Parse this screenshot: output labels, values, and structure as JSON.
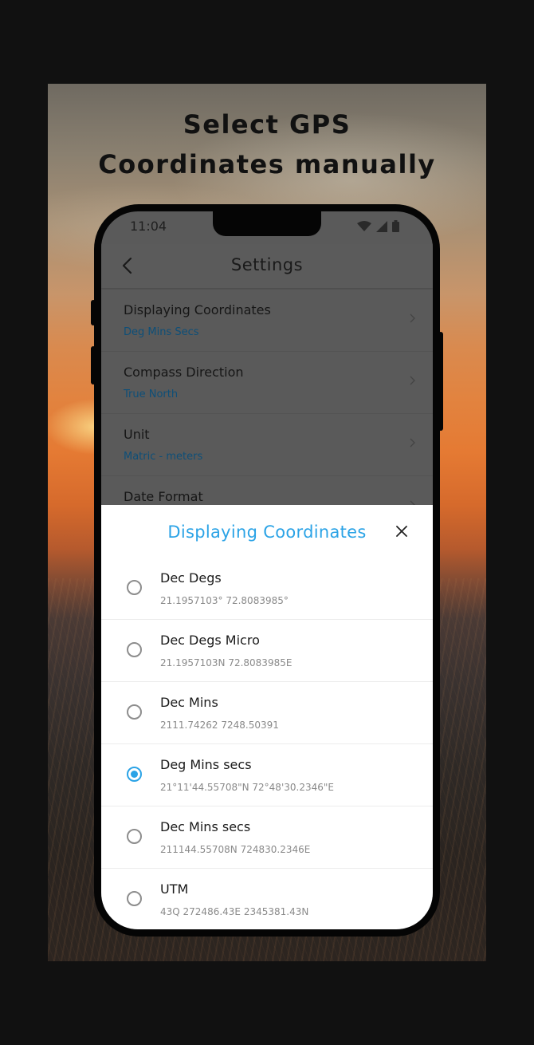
{
  "headline": {
    "line1": "Select GPS",
    "line2": "Coordinates manually"
  },
  "status_bar": {
    "time": "11:04",
    "icons": [
      "wifi-icon",
      "signal-icon",
      "battery-icon"
    ]
  },
  "app_bar": {
    "back_icon": "chevron-left-icon",
    "title": "Settings"
  },
  "settings": [
    {
      "title": "Displaying Coordinates",
      "value": "Deg Mins Secs"
    },
    {
      "title": "Compass Direction",
      "value": "True North"
    },
    {
      "title": "Unit",
      "value": "Matric - meters"
    },
    {
      "title": "Date Format",
      "value": ""
    }
  ],
  "sheet": {
    "title": "Displaying Coordinates",
    "close_icon": "close-icon",
    "options": [
      {
        "label": "Dec Degs",
        "sample": "21.1957103°  72.8083985°",
        "selected": false
      },
      {
        "label": "Dec Degs Micro",
        "sample": "21.1957103N  72.8083985E",
        "selected": false
      },
      {
        "label": "Dec Mins",
        "sample": "2111.74262  7248.50391",
        "selected": false
      },
      {
        "label": "Deg Mins secs",
        "sample": "21°11'44.55708\"N  72°48'30.2346\"E",
        "selected": true
      },
      {
        "label": "Dec Mins secs",
        "sample": "211144.55708N  724830.2346E",
        "selected": false
      },
      {
        "label": "UTM",
        "sample": "43Q  272486.43E  2345381.43N",
        "selected": false
      }
    ]
  },
  "colors": {
    "accent": "#2ba3e6",
    "setting_value": "#0e4f78",
    "dim_overlay": "#5a5a5a"
  }
}
